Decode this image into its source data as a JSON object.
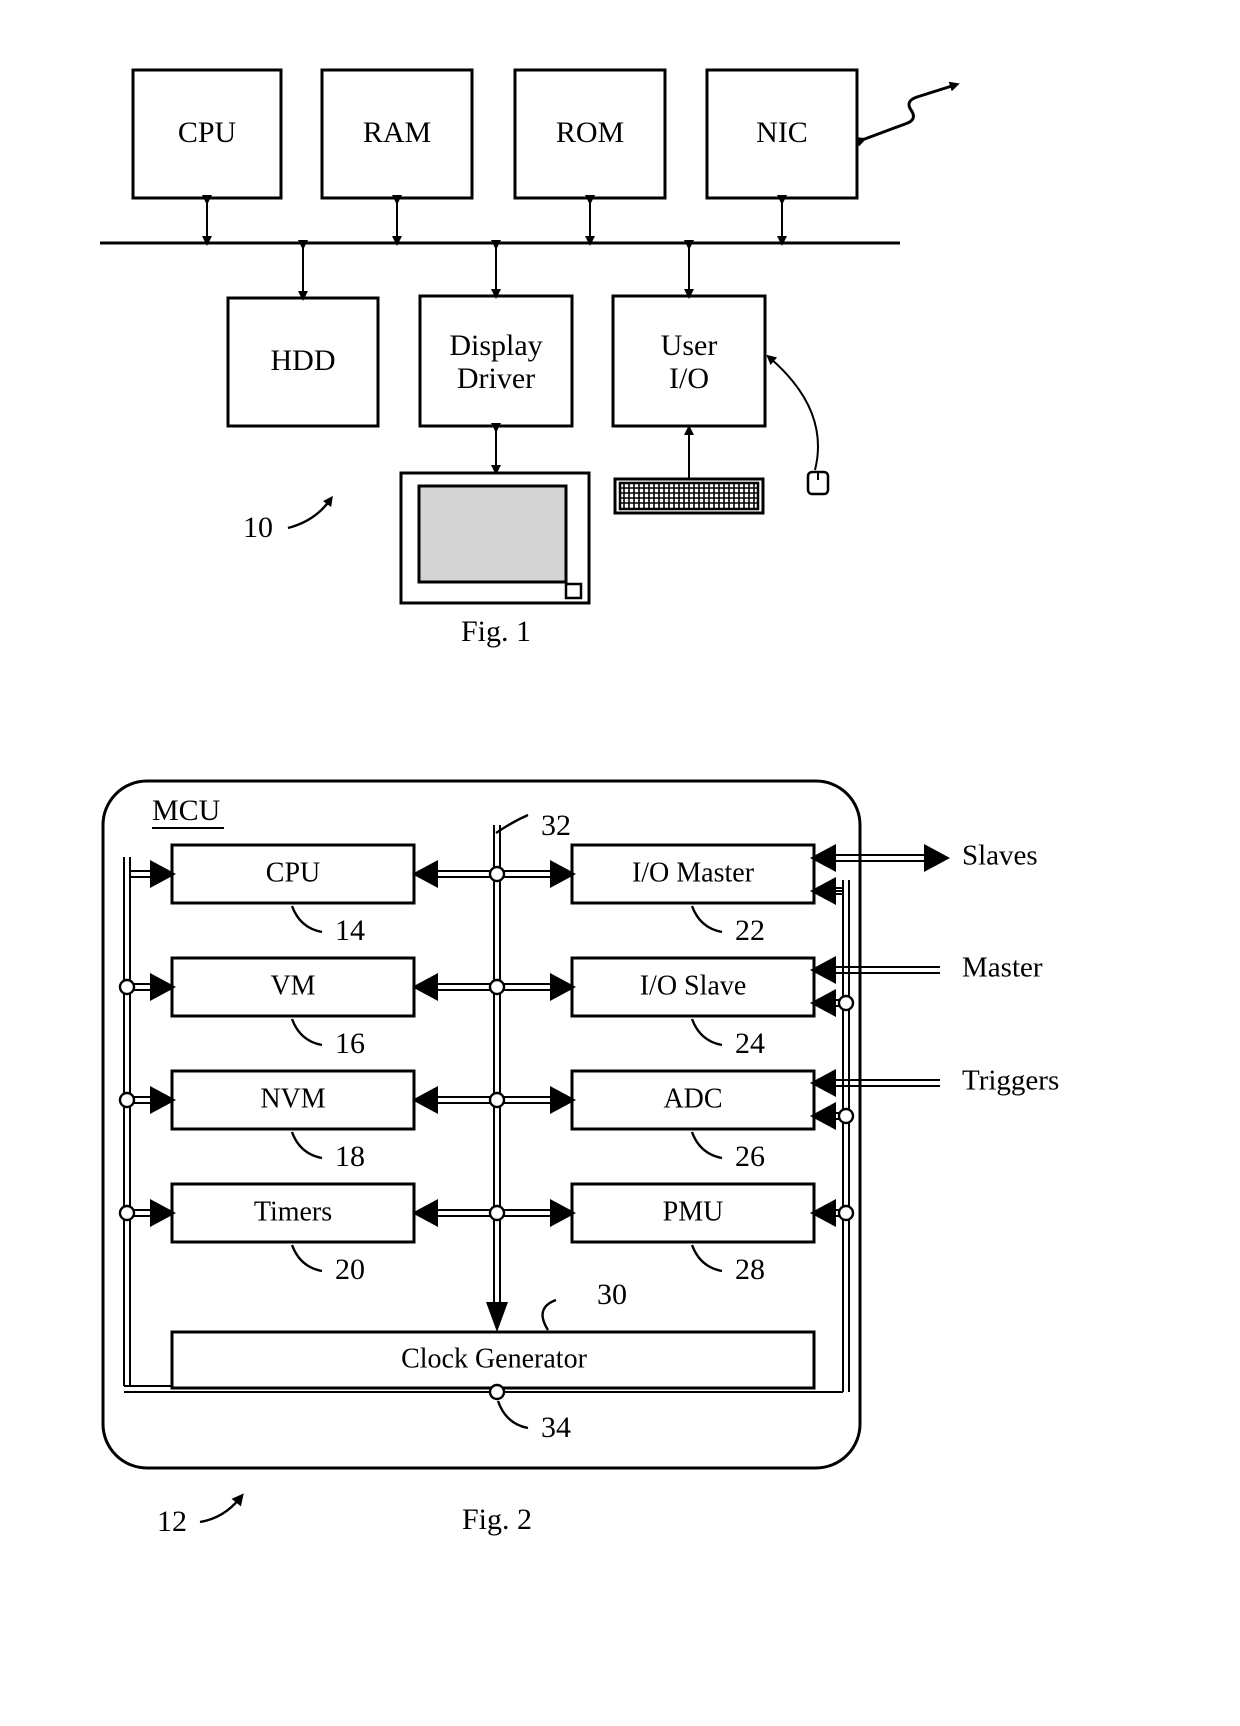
{
  "document": {
    "type": "patent-figure-sheet",
    "figures": [
      "Fig. 1",
      "Fig. 2"
    ]
  },
  "figure1": {
    "caption": "Fig. 1",
    "system_ref": "10",
    "bus_blocks_top": [
      {
        "label": "CPU"
      },
      {
        "label": "RAM"
      },
      {
        "label": "ROM"
      },
      {
        "label": "NIC"
      }
    ],
    "bus_blocks_bottom": [
      {
        "label": "HDD"
      },
      {
        "label_line1": "Display",
        "label_line2": "Driver"
      },
      {
        "label_line1": "User",
        "label_line2": "I/O"
      }
    ],
    "peripherals": [
      {
        "name": "monitor"
      },
      {
        "name": "keyboard"
      },
      {
        "name": "mouse"
      }
    ],
    "antenna": {
      "name": "wireless-link"
    }
  },
  "figure2": {
    "caption": "Fig. 2",
    "title": "MCU",
    "mcu_ref": "12",
    "left_column": [
      {
        "label": "CPU",
        "ref": "14"
      },
      {
        "label": "VM",
        "ref": "16"
      },
      {
        "label": "NVM",
        "ref": "18"
      },
      {
        "label": "Timers",
        "ref": "20"
      }
    ],
    "right_column": [
      {
        "label": "I/O Master",
        "ref": "22"
      },
      {
        "label": "I/O Slave",
        "ref": "24"
      },
      {
        "label": "ADC",
        "ref": "26"
      },
      {
        "label": "PMU",
        "ref": "28"
      }
    ],
    "clock_generator": {
      "label": "Clock Generator",
      "ref": "30"
    },
    "bus_ref": "32",
    "clock_out_ref": "34",
    "external_labels": [
      {
        "label": "Slaves"
      },
      {
        "label": "Master"
      },
      {
        "label": "Triggers"
      }
    ]
  },
  "colors": {
    "ink": "#000000",
    "paper": "#ffffff",
    "screen": "#d4d4d4"
  }
}
